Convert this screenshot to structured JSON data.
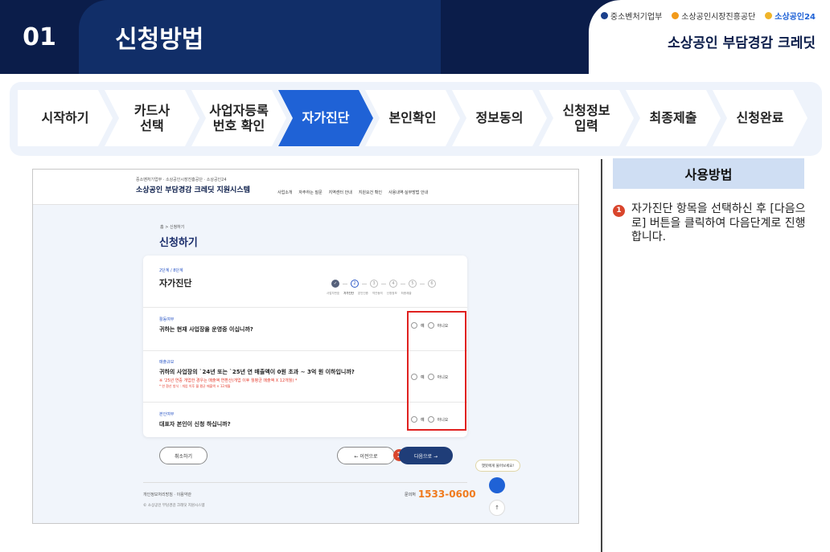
{
  "header": {
    "number": "01",
    "title": "신청방법",
    "logos": [
      "중소벤처기업부",
      "소상공인시장진흥공단",
      "소상공인24"
    ],
    "subtitle": "소상공인 부담경감 크레딧"
  },
  "steps": [
    {
      "label": "시작하기",
      "active": false
    },
    {
      "label": "카드사\n선택",
      "active": false
    },
    {
      "label": "사업자등록\n번호 확인",
      "active": false
    },
    {
      "label": "자가진단",
      "active": true
    },
    {
      "label": "본인확인",
      "active": false
    },
    {
      "label": "정보동의",
      "active": false
    },
    {
      "label": "신청정보\n입력",
      "active": false
    },
    {
      "label": "최종제출",
      "active": false
    },
    {
      "label": "신청완료",
      "active": false
    }
  ],
  "screenshot": {
    "brand_logos": "중소벤처기업부 · 소상공인시장진흥공단 · 소상공인24",
    "brand": "소상공인 부담경감 크레딧 지원시스템",
    "nav": [
      "사업소개",
      "자주하는 질문",
      "지역센터 안내",
      "지원요건 확인",
      "사용내역·실부방법 안내"
    ],
    "breadcrumb": "홈  >  신청하기",
    "page_title": "신청하기",
    "step_count": "2단계 / 8단계",
    "card_title": "자가진단",
    "progress_steps": [
      "",
      "2",
      "3",
      "4",
      "5",
      "6"
    ],
    "progress_labels": [
      "사업자번호",
      "자가진단",
      "본인인증",
      "약관동의",
      "신청정보",
      "최종제출"
    ],
    "questions": [
      {
        "tag": "활동여부",
        "text": "귀하는 현재 사업장을 운영중 이십니까?",
        "note": "",
        "tiny": ""
      },
      {
        "tag": "매출규모",
        "text": "귀하의 사업장의 `24년 또는 `25년 연 매출액이 0원 초과 ~ 3억 원 이하입니까?",
        "note": "※ '25년 연중 개업한 경우는 매출액 연환산(개업 이후 월평균 매출액 X 12개월) *",
        "tiny": "* 연 환산 방식 : 개업 이후 월 평균 매출액 × 12개월"
      },
      {
        "tag": "본인여부",
        "text": "대표자 본인이 신청 하십니까?",
        "note": "",
        "tiny": ""
      }
    ],
    "yes": "예",
    "no": "아니오",
    "cancel": "취소하기",
    "prev": "← 이전으로",
    "next": "다음으로 →",
    "chat_bubble": "챗봇에게 물어보세요!",
    "footer_links": "개인정보처리방침  ·  이용약관",
    "copyright": "© 소상공인 부담경감 크레딧 지원시스템",
    "phone_label": "문의처",
    "phone": "1533-0600",
    "badge_number": "1"
  },
  "usage": {
    "title": "사용방법",
    "badge": "1",
    "instruction": "자가진단 항목을 선택하신 후 [다음으로] 버튼을 클릭하여 다음단계로 진행합니다."
  },
  "colors": {
    "navy": "#0b1d4a",
    "active_step": "#1f62d6",
    "highlight": "#e0211f",
    "badge": "#d9452c"
  }
}
